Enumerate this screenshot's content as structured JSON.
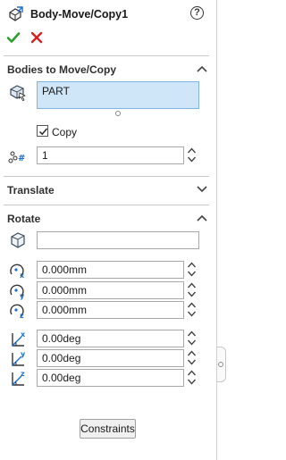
{
  "header": {
    "title": "Body-Move/Copy1",
    "help_label": "?"
  },
  "sections": {
    "bodies": {
      "title": "Bodies to Move/Copy",
      "list_value": "PART",
      "copy_label": "Copy",
      "copy_checked": true,
      "copies_count": "1"
    },
    "translate": {
      "title": "Translate"
    },
    "rotate": {
      "title": "Rotate",
      "origin_value": "",
      "x_offset": "0.000mm",
      "y_offset": "0.000mm",
      "z_offset": "0.000mm",
      "x_angle": "0.00deg",
      "y_angle": "0.00deg",
      "z_angle": "0.00deg"
    }
  },
  "footer": {
    "constraints_label": "Constraints"
  },
  "colors": {
    "ok": "#2e9e2e",
    "cancel": "#d62020",
    "selection_fill": "#cfe6f8",
    "selection_border": "#7fb4e0"
  },
  "icons": {
    "title": "move-copy-body-icon",
    "ok": "checkmark-icon",
    "cancel": "x-icon",
    "help": "help-circle-icon",
    "bodies": "solid-body-icon",
    "copies": "number-of-copies-icon",
    "origin": "cube-origin-icon",
    "x_offset": "x-delta-icon",
    "y_offset": "y-delta-icon",
    "z_offset": "z-delta-icon",
    "x_angle": "x-rotate-icon",
    "y_angle": "y-rotate-icon",
    "z_angle": "z-rotate-icon"
  }
}
